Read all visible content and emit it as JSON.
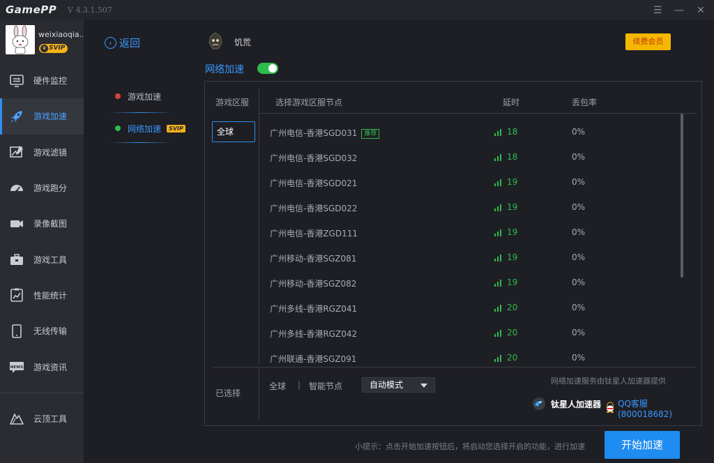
{
  "app": {
    "name": "GamePP",
    "version": "V 4.3.1.507"
  },
  "window_controls": {
    "menu": "☰",
    "minimize": "—",
    "close": "✕"
  },
  "user": {
    "name": "weixiaoqia..",
    "badge": "SVIP"
  },
  "sidebar": {
    "items": [
      {
        "label": "硬件监控",
        "icon": "hardware-monitor-icon"
      },
      {
        "label": "游戏加速",
        "icon": "rocket-icon",
        "active": true
      },
      {
        "label": "游戏滤镜",
        "icon": "filter-icon"
      },
      {
        "label": "游戏跑分",
        "icon": "speedometer-icon"
      },
      {
        "label": "录像截图",
        "icon": "video-camera-icon"
      },
      {
        "label": "游戏工具",
        "icon": "toolbox-icon"
      },
      {
        "label": "性能统计",
        "icon": "chart-clipboard-icon"
      },
      {
        "label": "无线传输",
        "icon": "tablet-icon"
      },
      {
        "label": "游戏资讯",
        "icon": "news-icon"
      }
    ],
    "cloud": {
      "label": "云顶工具",
      "icon": "mountain-icon"
    }
  },
  "subnav": {
    "back": "返回",
    "items": [
      {
        "label": "游戏加速",
        "dot_color": "#d9413b"
      },
      {
        "label": "网络加速",
        "dot_color": "#2ebc4f",
        "badge": "SVIP"
      }
    ]
  },
  "game": {
    "name": "饥荒",
    "renew": "续费会员"
  },
  "network": {
    "title": "网络加速",
    "enabled": true
  },
  "table": {
    "headers": {
      "region": "游戏区服",
      "node": "选择游戏区服节点",
      "latency": "延时",
      "loss": "丢包率"
    },
    "region_selected": "全球",
    "recommend_tag": "推荐",
    "rows": [
      {
        "node": "广州电信-香港SGD031",
        "latency": "18",
        "loss": "0%",
        "recommended": true
      },
      {
        "node": "广州电信-香港SGD032",
        "latency": "18",
        "loss": "0%"
      },
      {
        "node": "广州电信-香港SGD021",
        "latency": "19",
        "loss": "0%"
      },
      {
        "node": "广州电信-香港SGD022",
        "latency": "19",
        "loss": "0%"
      },
      {
        "node": "广州电信-香港ZGD111",
        "latency": "19",
        "loss": "0%"
      },
      {
        "node": "广州移动-香港SGZ081",
        "latency": "19",
        "loss": "0%"
      },
      {
        "node": "广州移动-香港SGZ082",
        "latency": "19",
        "loss": "0%"
      },
      {
        "node": "广州多线-香港RGZ041",
        "latency": "20",
        "loss": "0%"
      },
      {
        "node": "广州多线-香港RGZ042",
        "latency": "20",
        "loss": "0%"
      },
      {
        "node": "广州联通-香港SGZ091",
        "latency": "20",
        "loss": "0%"
      }
    ]
  },
  "selection": {
    "label": "已选择",
    "region": "全球",
    "separator": "|",
    "node": "智能节点",
    "mode": "自动模式",
    "provider_text": "网络加速服务由钛星人加速器提供",
    "brand": "钛星人加速器",
    "qq_support": "QQ客服(800018682)"
  },
  "footer": {
    "hint": "小提示：点击开始加速按钮后，将启动您选择开启的功能，进行加速",
    "start": "开始加速"
  },
  "colors": {
    "accent": "#2e8ff0",
    "good": "#2ebc4f",
    "gold": "#f5b800"
  }
}
